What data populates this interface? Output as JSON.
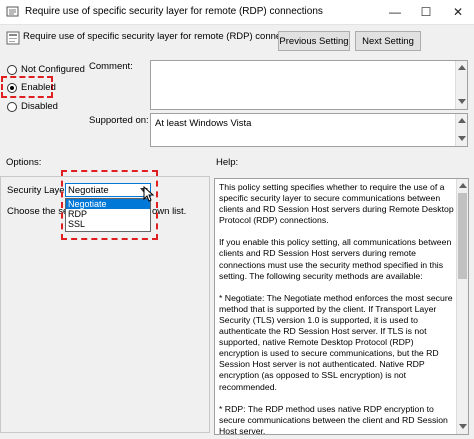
{
  "window": {
    "title": "Require use of specific security layer for remote (RDP) connections",
    "minimize_glyph": "—",
    "maximize_glyph": "☐",
    "close_glyph": "✕"
  },
  "header": {
    "policy_name": "Require use of specific security layer for remote (RDP) connections",
    "previous_label": "Previous Setting",
    "next_label": "Next Setting"
  },
  "state": {
    "not_configured_label": "Not Configured",
    "enabled_label": "Enabled",
    "disabled_label": "Disabled",
    "selected": "enabled"
  },
  "comment": {
    "label": "Comment:",
    "value": ""
  },
  "supported": {
    "label": "Supported on:",
    "value": "At least Windows Vista"
  },
  "options": {
    "label": "Options:",
    "security_layer_label": "Security Layer",
    "selected_value": "Negotiate",
    "dropdown_options": [
      "Negotiate",
      "RDP",
      "SSL"
    ],
    "choose_text_start": "Choose the se",
    "choose_text_end": "own list."
  },
  "help": {
    "label": "Help:",
    "paragraphs": [
      "This policy setting specifies whether to require the use of a specific security layer to secure communications between clients and RD Session Host servers during Remote Desktop Protocol (RDP) connections.",
      "If you enable this policy setting, all communications between clients and RD Session Host servers during remote connections must use the security method specified in this setting. The following security methods are available:",
      "* Negotiate: The Negotiate method enforces the most secure method that is supported by the client. If Transport Layer Security (TLS) version 1.0 is supported, it is used to authenticate the RD Session Host server. If TLS is not supported, native Remote Desktop Protocol (RDP) encryption is used to secure communications, but the RD Session Host server is not authenticated. Native RDP encryption (as opposed to SSL encryption) is not recommended.",
      "* RDP: The RDP method uses native RDP encryption to secure communications between the client and RD Session Host server."
    ]
  },
  "colors": {
    "highlight_dash": "#e02020",
    "selection": "#0078d7",
    "dialog_bg": "#f0f0f0"
  }
}
